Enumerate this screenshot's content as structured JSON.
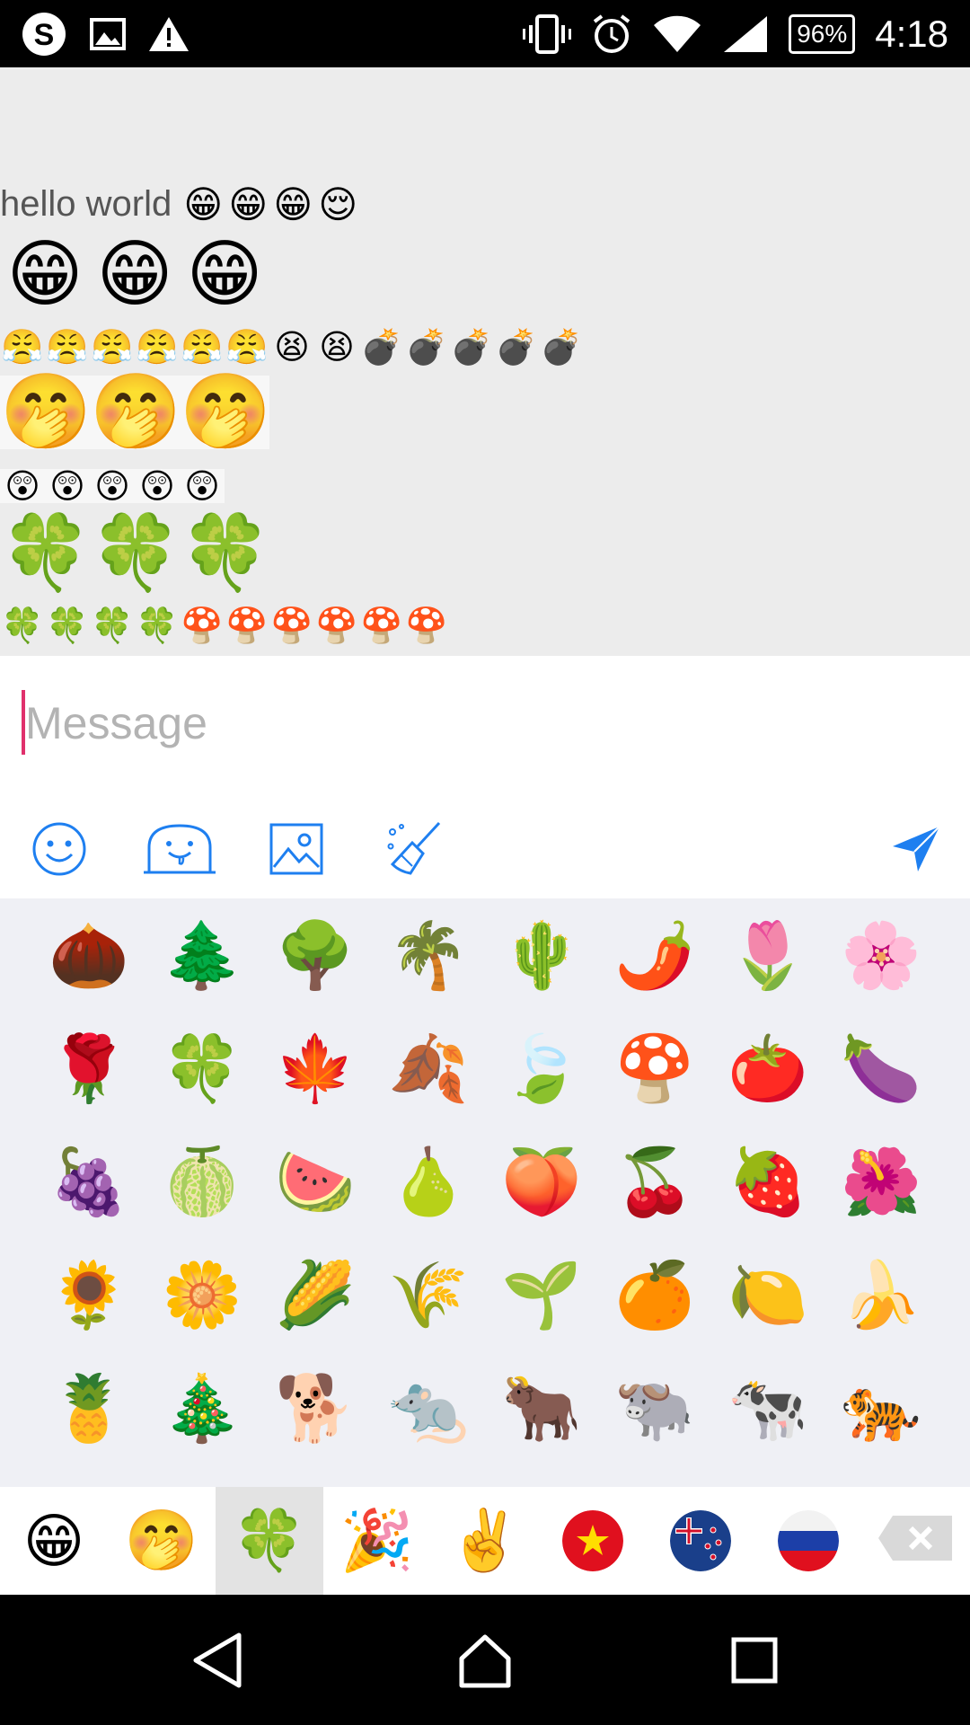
{
  "status_bar": {
    "battery_percent": "96%",
    "time": "4:18",
    "left_icons": [
      "skype-icon",
      "image-icon",
      "warning-icon"
    ],
    "right_icons": [
      "vibrate-icon",
      "alarm-icon",
      "wifi-icon",
      "signal-icon"
    ]
  },
  "chat": {
    "text": "hello world",
    "row1_emojis": [
      "😁",
      "😁",
      "😁",
      "😌"
    ],
    "row2_emojis": [
      "😁",
      "😁",
      "😁"
    ],
    "row3_emojis": [
      "😤",
      "😤",
      "😤",
      "😤",
      "😤",
      "😤",
      "😫",
      "😫",
      "💣",
      "💣",
      "💣",
      "💣",
      "💣"
    ],
    "row4_emojis": [
      "🤭",
      "🤭",
      "🤭"
    ],
    "row5_emojis": [
      "😲",
      "😲",
      "😲",
      "😲",
      "😲"
    ],
    "row6_emojis": [
      "🍀",
      "🍀",
      "🍀"
    ],
    "row7_emojis": [
      "🍀",
      "🍀",
      "🍀",
      "🍀",
      "🍄",
      "🍄",
      "🍄",
      "🍄",
      "🍄",
      "🍄"
    ]
  },
  "input": {
    "placeholder": "Message",
    "value": ""
  },
  "toolbar": {
    "icons": [
      "smiley-icon",
      "sticker-icon",
      "picture-icon",
      "clear-brush-icon"
    ],
    "send_icon": "send-icon",
    "accent_color": "#1e7ff0"
  },
  "emoji_grid": [
    [
      "🌰",
      "🌲",
      "🌳",
      "🌴",
      "🌵",
      "🌶️",
      "🌷",
      "🌸"
    ],
    [
      "🌹",
      "🍀",
      "🍁",
      "🍂",
      "🍃",
      "🍄",
      "🍅",
      "🍆"
    ],
    [
      "🍇",
      "🍈",
      "🍉",
      "🍐",
      "🍑",
      "🍒",
      "🍓",
      "🌺"
    ],
    [
      "🌻",
      "🌼",
      "🌽",
      "🌾",
      "🌱",
      "🍊",
      "🍋",
      "🍌"
    ],
    [
      "🍍",
      "🎄",
      "🐕",
      "🐀",
      "🐂",
      "🐃",
      "🐄",
      "🐅"
    ]
  ],
  "categories": {
    "items": [
      "😁",
      "🤭",
      "🍀",
      "🎉",
      "✌️"
    ],
    "flags": [
      "vietnam-flag-icon",
      "new-zealand-flag-icon",
      "russia-flag-icon"
    ],
    "active_index": 2
  },
  "nav": {
    "icons": [
      "back-icon",
      "home-icon",
      "recents-icon"
    ]
  }
}
